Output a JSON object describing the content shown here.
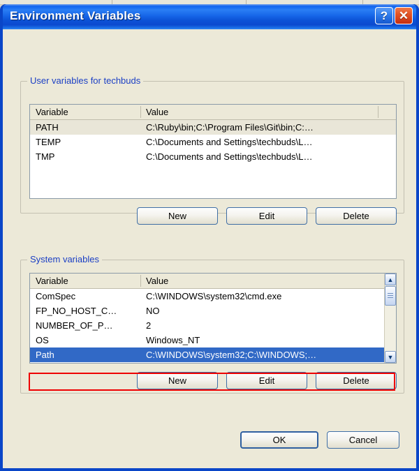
{
  "window": {
    "title": "Environment Variables",
    "help_button": "?",
    "close_button": "✕"
  },
  "user_section": {
    "label": "User variables for techbuds",
    "columns": [
      "Variable",
      "Value"
    ],
    "rows": [
      {
        "variable": "PATH",
        "value": "C:\\Ruby\\bin;C:\\Program Files\\Git\\bin;C:…",
        "selected": true
      },
      {
        "variable": "TEMP",
        "value": "C:\\Documents and Settings\\techbuds\\L…",
        "selected": false
      },
      {
        "variable": "TMP",
        "value": "C:\\Documents and Settings\\techbuds\\L…",
        "selected": false
      }
    ],
    "buttons": {
      "new": "New",
      "edit": "Edit",
      "delete": "Delete"
    }
  },
  "system_section": {
    "label": "System variables",
    "columns": [
      "Variable",
      "Value"
    ],
    "rows": [
      {
        "variable": "ComSpec",
        "value": "C:\\WINDOWS\\system32\\cmd.exe",
        "selected": false
      },
      {
        "variable": "FP_NO_HOST_C…",
        "value": "NO",
        "selected": false
      },
      {
        "variable": "NUMBER_OF_P…",
        "value": "2",
        "selected": false
      },
      {
        "variable": "OS",
        "value": "Windows_NT",
        "selected": false
      },
      {
        "variable": "Path",
        "value": "C:\\WINDOWS\\system32;C:\\WINDOWS;…",
        "selected": true
      }
    ],
    "buttons": {
      "new": "New",
      "edit": "Edit",
      "delete": "Delete"
    },
    "scrollbar": {
      "up_arrow": "▲",
      "down_arrow": "▼"
    }
  },
  "dialog_buttons": {
    "ok": "OK",
    "cancel": "Cancel"
  },
  "colors": {
    "titlebar_blue": "#0f63ef",
    "client_beige": "#ece9d8",
    "group_label_blue": "#1b3fc4",
    "selection_blue": "#3169c6",
    "inactive_selection": "#e9e6d8",
    "annotation_red": "#ee0000",
    "close_red": "#e35426"
  }
}
